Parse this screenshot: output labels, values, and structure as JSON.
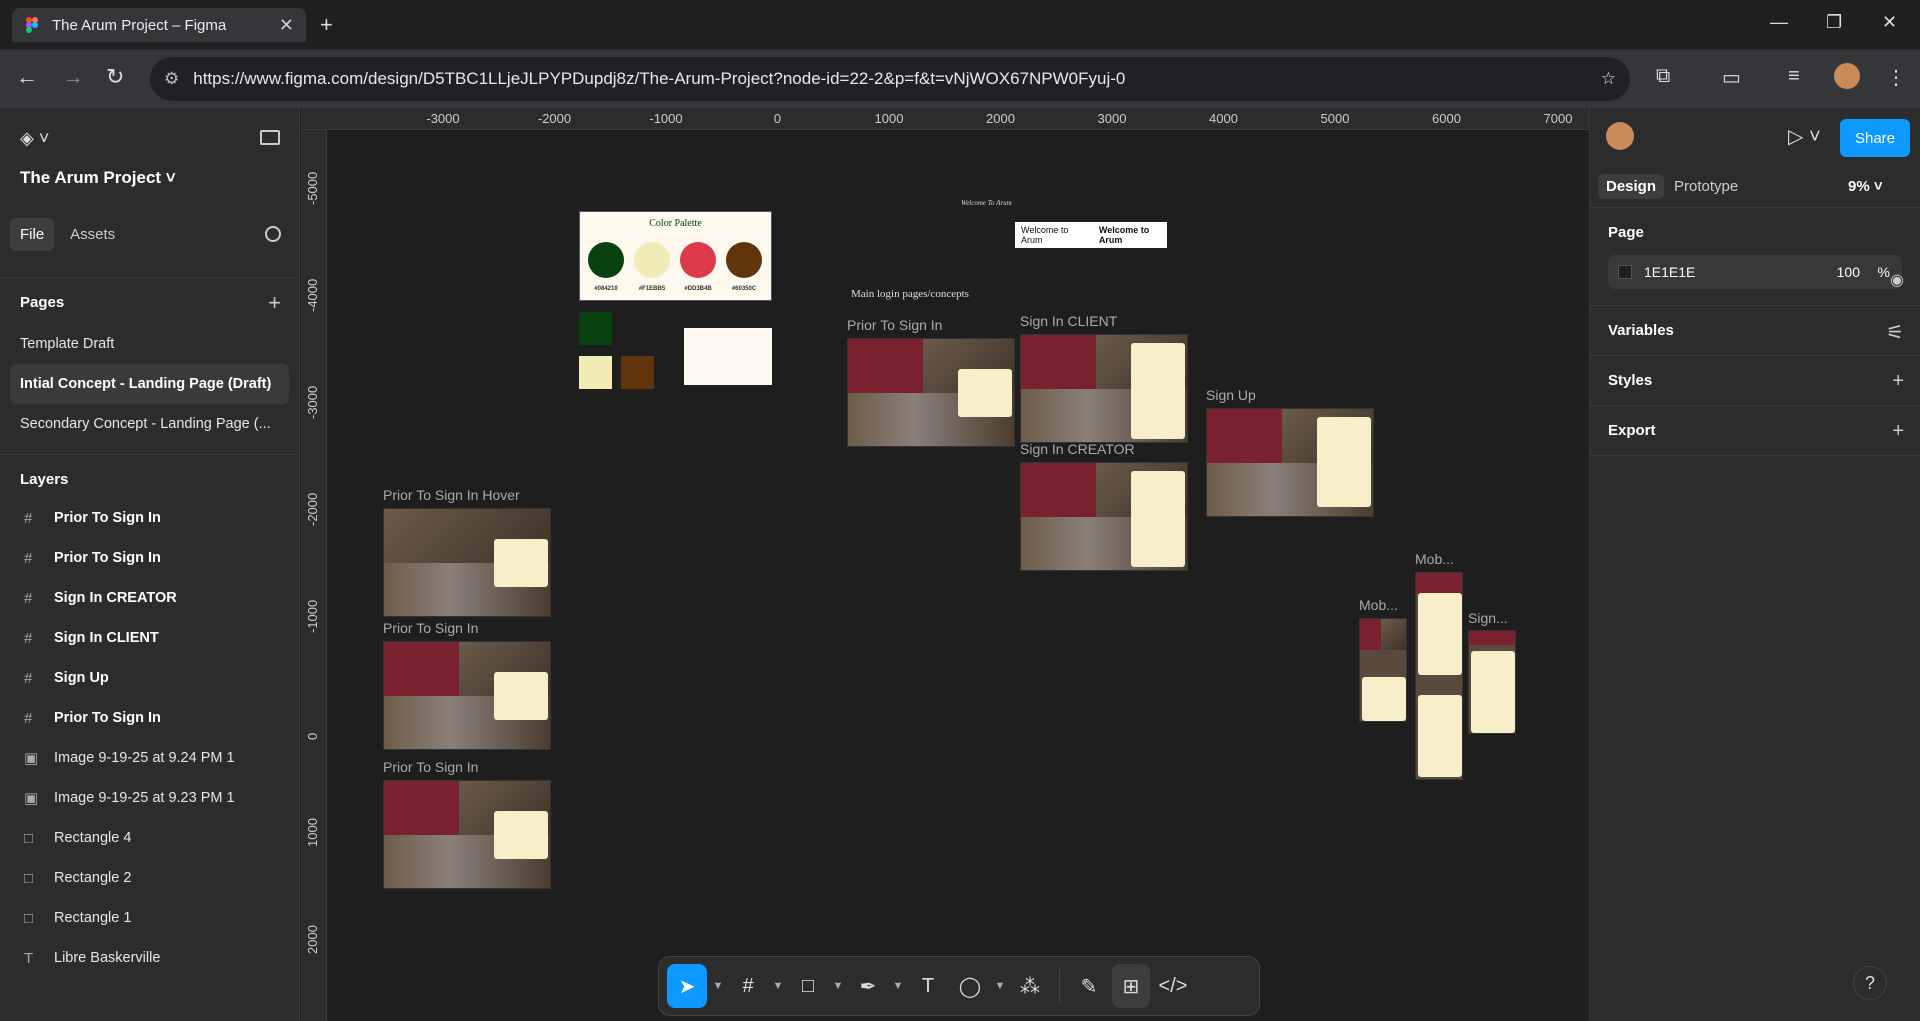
{
  "browser": {
    "tab_title": "The Arum Project – Figma",
    "url": "https://www.figma.com/design/D5TBC1LLjeJLPYPDupdj8z/The-Arum-Project?node-id=22-2&p=f&t=vNjWOX67NPW0Fyuj-0"
  },
  "left": {
    "project": "The Arum Project",
    "tab_file": "File",
    "tab_assets": "Assets",
    "pages_title": "Pages",
    "pages": [
      "Template Draft",
      "Intial Concept - Landing Page (Draft)",
      "Secondary Concept - Landing Page (..."
    ],
    "layers_title": "Layers",
    "layers": [
      {
        "icon": "#",
        "name": "Prior To Sign In",
        "kind": "frame"
      },
      {
        "icon": "#",
        "name": "Prior To Sign In",
        "kind": "frame"
      },
      {
        "icon": "#",
        "name": "Sign In CREATOR",
        "kind": "frame"
      },
      {
        "icon": "#",
        "name": "Sign In CLIENT",
        "kind": "frame"
      },
      {
        "icon": "#",
        "name": "Sign Up",
        "kind": "frame"
      },
      {
        "icon": "#",
        "name": "Prior To Sign In",
        "kind": "frame"
      },
      {
        "icon": "▣",
        "name": "Image 9-19-25 at 9.24 PM 1",
        "kind": "image"
      },
      {
        "icon": "▣",
        "name": "Image 9-19-25 at 9.23 PM 1",
        "kind": "image"
      },
      {
        "icon": "□",
        "name": "Rectangle 4",
        "kind": "rect"
      },
      {
        "icon": "□",
        "name": "Rectangle 2",
        "kind": "rect"
      },
      {
        "icon": "□",
        "name": "Rectangle 1",
        "kind": "rect"
      },
      {
        "icon": "T",
        "name": "Libre Baskerville",
        "kind": "text"
      }
    ]
  },
  "rulers": {
    "top": [
      "-3000",
      "-2000",
      "-1000",
      "0",
      "1000",
      "2000",
      "3000",
      "4000",
      "5000",
      "6000",
      "7000"
    ],
    "left": [
      "-5000",
      "-4000",
      "-3000",
      "-2000",
      "-1000",
      "0",
      "1000",
      "2000"
    ]
  },
  "canvas": {
    "frames": [
      {
        "label": "Prior To Sign In Hover"
      },
      {
        "label": "Prior To Sign In"
      },
      {
        "label": "Prior To Sign In"
      },
      {
        "label": "Prior To Sign In"
      },
      {
        "label": "Sign In CLIENT"
      },
      {
        "label": "Sign In CREATOR"
      },
      {
        "label": "Sign Up"
      },
      {
        "label": "Mob..."
      },
      {
        "label": "Mob..."
      },
      {
        "label": "Sign..."
      }
    ],
    "palette_title": "Color Palette",
    "palette": [
      {
        "hex": "#084210",
        "color": "#084210"
      },
      {
        "hex": "#F1EBB5",
        "color": "#F1EBB5"
      },
      {
        "hex": "#DD3B4B",
        "color": "#DD3B4B"
      },
      {
        "hex": "#60350C",
        "color": "#60350C"
      }
    ],
    "section_heading": "Main login pages/concepts",
    "welcome_small": "Welcome To Arum",
    "welcome_plain": "Welcome to Arum",
    "welcome_bold": "Welcome to Arum"
  },
  "right": {
    "tab_design": "Design",
    "tab_prototype": "Prototype",
    "zoom": "9%",
    "share": "Share",
    "page_title": "Page",
    "page_fill": "1E1E1E",
    "page_opacity": "100",
    "page_pct": "%",
    "variables": "Variables",
    "styles": "Styles",
    "export": "Export"
  },
  "colors": {
    "accent": "#0d99ff",
    "canvas_bg": "#1E1E1E"
  }
}
